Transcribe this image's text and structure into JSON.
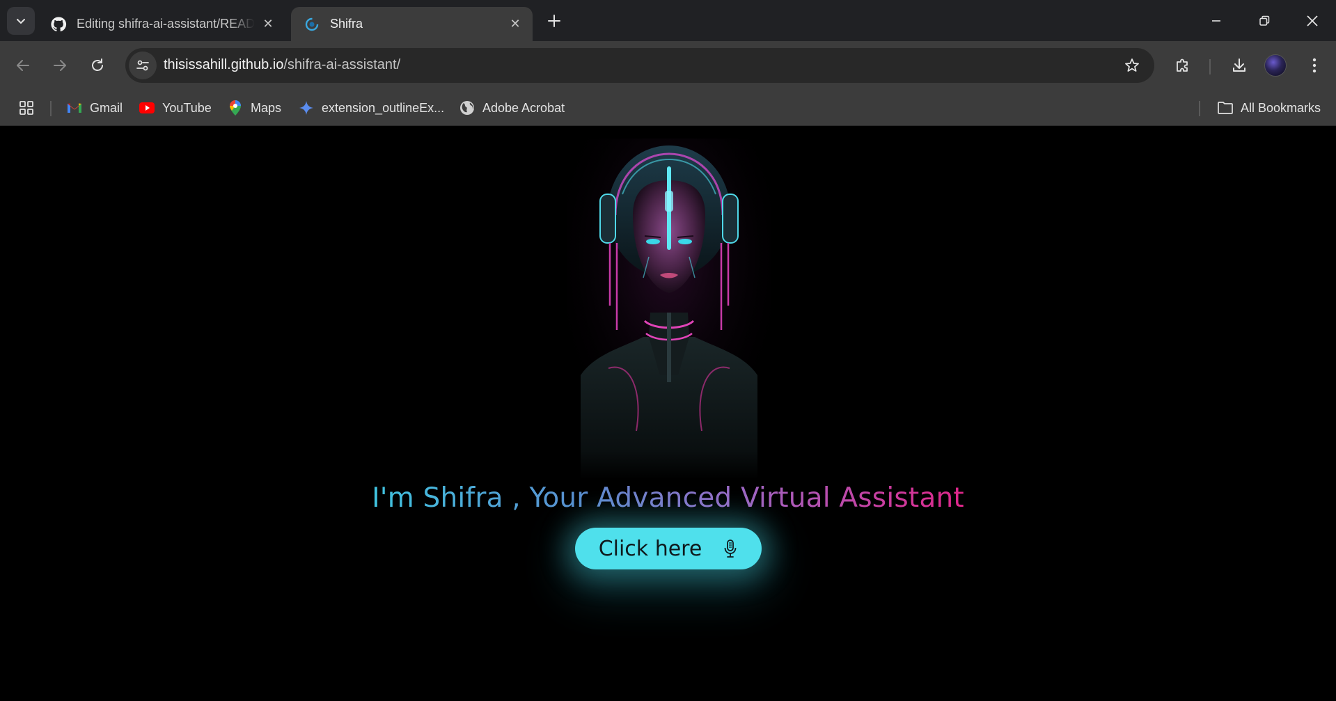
{
  "browser": {
    "tabs": [
      {
        "title": "Editing shifra-ai-assistant/READ",
        "favicon": "github-icon"
      },
      {
        "title": "Shifra",
        "favicon": "shifra-icon"
      }
    ],
    "address": {
      "host": "thisissahill.github.io",
      "path": "/shifra-ai-assistant/"
    },
    "bookmarks": [
      {
        "label": "Gmail",
        "icon": "gmail-icon"
      },
      {
        "label": "YouTube",
        "icon": "youtube-icon"
      },
      {
        "label": "Maps",
        "icon": "maps-icon"
      },
      {
        "label": "extension_outlineEx...",
        "icon": "sparkle-icon"
      },
      {
        "label": "Adobe Acrobat",
        "icon": "globe-icon"
      }
    ],
    "all_bookmarks_label": "All Bookmarks"
  },
  "page": {
    "headline": "I'm Shifra , Your Advanced Virtual Assistant",
    "cta_label": "Click here",
    "cta_icon": "microphone-icon",
    "colors": {
      "cta": "#4fe0ec",
      "headline_start": "#40c4e0",
      "headline_end": "#e0268a"
    }
  }
}
